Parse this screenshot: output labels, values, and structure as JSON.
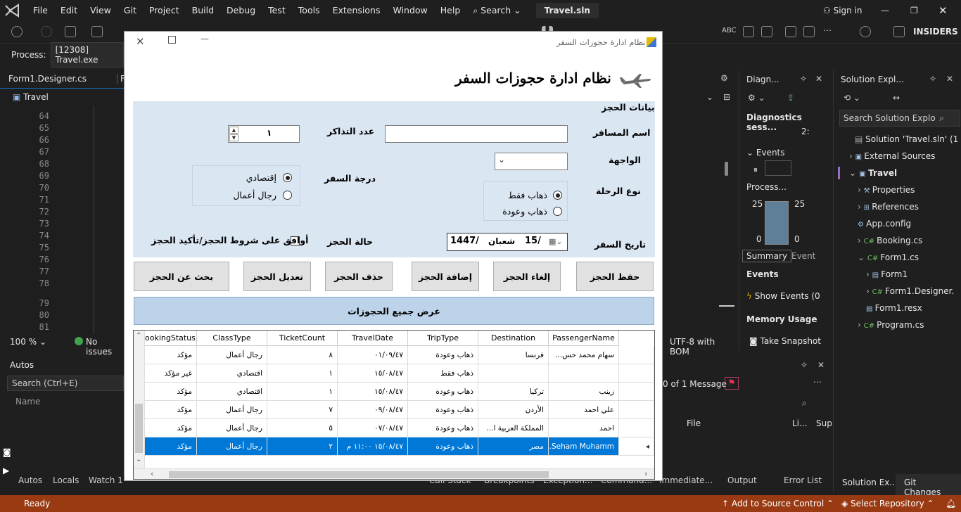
{
  "menu": [
    "File",
    "Edit",
    "View",
    "Git",
    "Project",
    "Build",
    "Debug",
    "Test",
    "Tools",
    "Extensions",
    "Window",
    "Help"
  ],
  "search_label": "Search",
  "solution_title": "Travel.sln",
  "sign_in": "Sign in",
  "insiders": "INSIDERS",
  "process_label": "Process:",
  "process_value": "[12308] Travel.exe",
  "doc_tab": "Form1.Designer.cs",
  "doc_tab2": "F",
  "project_combo": "Travel",
  "line_numbers": [
    "64",
    "65",
    "66",
    "67",
    "68",
    "69",
    "70",
    "71",
    "72",
    "73",
    "74",
    "75",
    "76",
    "77",
    "78",
    "79",
    "80",
    "81",
    "82"
  ],
  "zoom": "100 %",
  "no_issues": "No issues",
  "encoding": "UTF-8 with BOM",
  "autos": {
    "title": "Autos",
    "search": "Search (Ctrl+E)",
    "col_name": "Name"
  },
  "bottom_tabs": [
    "Autos",
    "Locals",
    "Watch 1",
    "Call Stack",
    "Breakpoints",
    "Exception...",
    "Command...",
    "Immediate...",
    "Output",
    "Error List"
  ],
  "errors": {
    "message": "0 of 1 Message",
    "file_col": "File",
    "line_col": "Li...",
    "sup_col": "Sup"
  },
  "status": {
    "ready": "Ready",
    "add_source": "Add to Source Control",
    "select_repo": "Select Repository"
  },
  "diag": {
    "title": "Diagn...",
    "session": "Diagnostics sess...",
    "time": "2:",
    "events": "Events",
    "process": "Process...",
    "val1": "25",
    "val2": "25",
    "zero1": "0",
    "zero2": "0",
    "summary": "Summary",
    "event_tab": "Event",
    "events_hdr": "Events",
    "show_events": "Show Events (0",
    "memory": "Memory Usage",
    "snapshot": "Take Snapshot"
  },
  "solution": {
    "title": "Solution Expl...",
    "search": "Search Solution Explo",
    "root": "Solution 'Travel.sln' (1 c",
    "items": [
      {
        "label": "External Sources",
        "indent": 1,
        "icon": "folder-icon"
      },
      {
        "label": "Travel",
        "indent": 1,
        "icon": "csharp-project-icon"
      },
      {
        "label": "Properties",
        "indent": 2,
        "icon": "wrench-icon"
      },
      {
        "label": "References",
        "indent": 2,
        "icon": "references-icon"
      },
      {
        "label": "App.config",
        "indent": 2,
        "icon": "config-icon"
      },
      {
        "label": "Booking.cs",
        "indent": 2,
        "icon": "csharp-file-icon"
      },
      {
        "label": "Form1.cs",
        "indent": 2,
        "icon": "csharp-file-icon"
      },
      {
        "label": "Form1",
        "indent": 3,
        "icon": "form-icon"
      },
      {
        "label": "Form1.Designer.",
        "indent": 3,
        "icon": "csharp-file-icon"
      },
      {
        "label": "Form1.resx",
        "indent": 3,
        "icon": "resx-icon"
      },
      {
        "label": "Program.cs",
        "indent": 2,
        "icon": "csharp-file-icon"
      }
    ],
    "tab1": "Solution Ex...",
    "tab2": "Git Changes"
  },
  "dialog": {
    "window_title": "نظام ادارة حجوزات السفر",
    "header": "نظام ادارة حجوزات السفر",
    "group": "بيانات الحجز",
    "passenger_label": "اسم المسافر",
    "tickets_label": "عدد التذاكر",
    "tickets_value": "١",
    "destination_label": "الواجهة",
    "class_label": "درجة السفر",
    "class_economy": "إقتصادي",
    "class_business": "رجال أعمال",
    "trip_label": "نوع الرحلة",
    "trip_oneway": "ذهاب فقط",
    "trip_round": "ذهاب وعودة",
    "date_label": "تاريخ السفر",
    "date_day": "15/",
    "date_month": "شعبان",
    "date_year": "1447/",
    "status_label": "حالة الحجز",
    "agree_label": "أوافق على شروط الحجز/تأكيد الحجز",
    "buttons": {
      "save": "حفظ الحجز",
      "cancel": "إلغاء الحجز",
      "add": "إضافة الحجز",
      "delete": "حذف الحجز",
      "edit": "تعديل الحجز",
      "search": "بحث عن  الحجز"
    },
    "show_all": "عرض جميع الحجوزات",
    "grid": {
      "columns": [
        "ookingStatus",
        "ClassType",
        "TicketCount",
        "TravelDate",
        "TripType",
        "Destination",
        "PassengerName"
      ],
      "rows": [
        [
          "مؤكد",
          "رجال أعمال",
          "٨",
          "٠١/٠٩/٤٧",
          "ذهاب وعودة",
          "فرنسا",
          "سهام محمد حس..."
        ],
        [
          "غير مؤكد",
          "اقتصادي",
          "١",
          "١٥/٠٨/٤٧",
          "ذهاب فقط",
          "",
          ""
        ],
        [
          "مؤكد",
          "اقتصادي",
          "١",
          "١٥/٠٨/٤٧",
          "ذهاب وعودة",
          "تركيا",
          "زينب"
        ],
        [
          "مؤكد",
          "رجال أعمال",
          "٧",
          "٠٩/٠٨/٤٧",
          "ذهاب وعودة",
          "الأردن",
          "علي احمد"
        ],
        [
          "مؤكد",
          "رجال أعمال",
          "٥",
          "٠٧/٠٨/٤٧",
          "ذهاب وعودة",
          "المملكة العربية ا...",
          "احمد"
        ],
        [
          "مؤكد",
          "رجال أعمال",
          "٢",
          "١٥/٠٨/٤٧ ١١:٠٠ م",
          "ذهاب وعودة",
          "مصر",
          "Seham Muhamm..."
        ]
      ]
    }
  },
  "colors": {
    "accent": "#0078d7",
    "status": "#9a3a12",
    "form_bg": "#dbe6f3"
  }
}
